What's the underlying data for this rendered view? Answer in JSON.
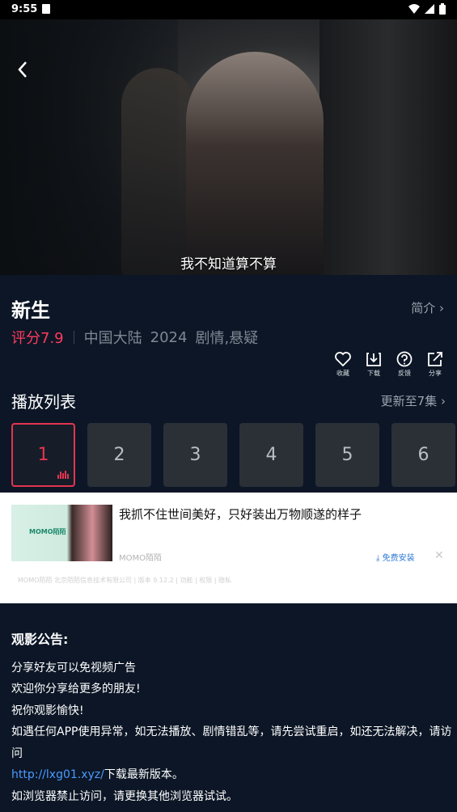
{
  "status": {
    "time": "9:55"
  },
  "video": {
    "subtitle": "我不知道算不算"
  },
  "show": {
    "title": "新生",
    "intro_label": "简介",
    "rating": "评分7.9",
    "region": "中国大陆",
    "year": "2024",
    "genres": "剧情,悬疑"
  },
  "actions": [
    {
      "icon": "heart-icon",
      "label": "收藏"
    },
    {
      "icon": "download-icon",
      "label": "下载"
    },
    {
      "icon": "feedback-icon",
      "label": "反馈"
    },
    {
      "icon": "share-icon",
      "label": "分享"
    }
  ],
  "playlist": {
    "title": "播放列表",
    "more": "更新至7集",
    "episodes": [
      "1",
      "2",
      "3",
      "4",
      "5",
      "6"
    ],
    "active_index": 0
  },
  "ad": {
    "thumb_logo": "MOMO陌陌",
    "headline": "我抓不住世间美好，只好装出万物顺遂的样子",
    "brand": "MOMO陌陌",
    "install": "免费安装",
    "legal": "MOMO陌陌 北京陌陌信息技术有限公司 | 版本 9.12.2 | 功能 | 权限 | 隐私"
  },
  "notice": {
    "title": "观影公告:",
    "lines": [
      "分享好友可以免视频广告",
      "欢迎你分享给更多的朋友!",
      "祝你观影愉快!",
      "如遇任何APP使用异常，如无法播放、剧情错乱等，请先尝试重启，如还无法解决，请访问"
    ],
    "link": "http://lxg01.xyz/",
    "link_suffix": "下载最新版本。",
    "line_after": "如浏览器禁止访问，请更换其他浏览器试试。"
  },
  "colors": {
    "accent": "#e5344f",
    "background": "#0c1626",
    "link": "#4a9bff"
  }
}
